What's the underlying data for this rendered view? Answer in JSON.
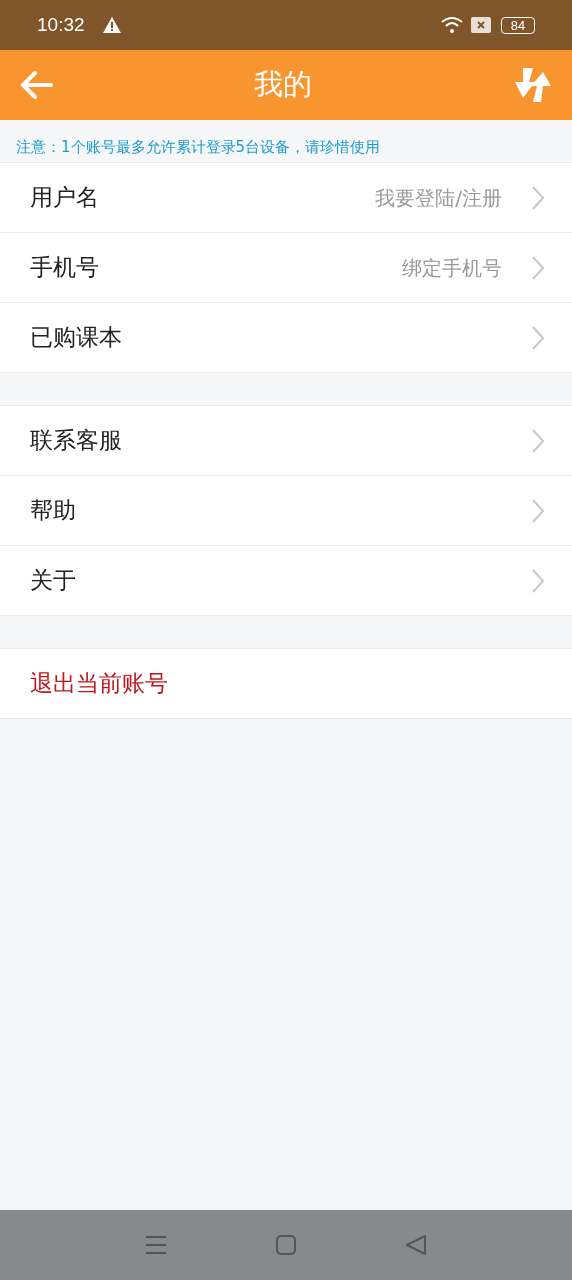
{
  "status_bar": {
    "time": "10:32",
    "battery": "84"
  },
  "header": {
    "title": "我的"
  },
  "notice": "注意：1个账号最多允许累计登录5台设备，请珍惜使用",
  "groups": [
    [
      {
        "label": "用户名",
        "value": "我要登陆/注册"
      },
      {
        "label": "手机号",
        "value": "绑定手机号"
      },
      {
        "label": "已购课本"
      }
    ],
    [
      {
        "label": "联系客服"
      },
      {
        "label": "帮助"
      },
      {
        "label": "关于"
      }
    ]
  ],
  "logout": "退出当前账号"
}
